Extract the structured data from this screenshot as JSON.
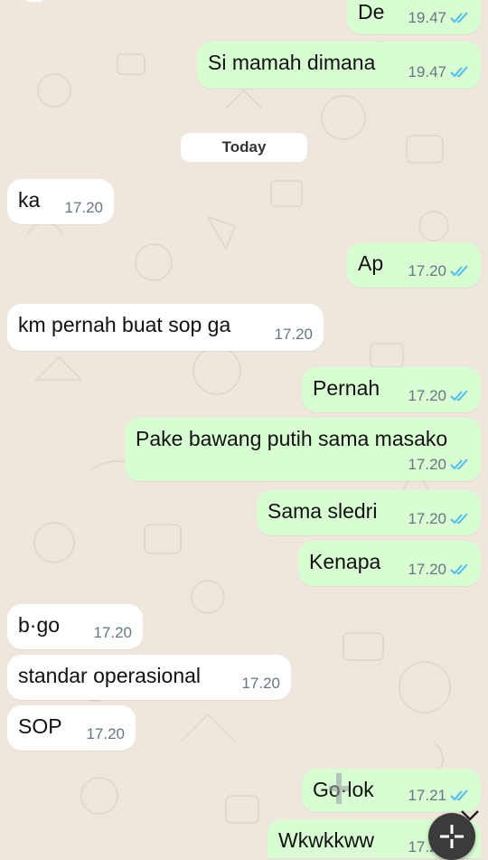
{
  "date_separator": "Today",
  "messages": [
    {
      "text": "De",
      "time": "19.47",
      "dir": "out",
      "read": true
    },
    {
      "text": "Si mamah dimana",
      "time": "19.47",
      "dir": "out",
      "read": true
    },
    {
      "text": "ka",
      "time": "17.20",
      "dir": "in"
    },
    {
      "text": "Ap",
      "time": "17.20",
      "dir": "out",
      "read": true
    },
    {
      "text": "km pernah buat sop ga",
      "time": "17.20",
      "dir": "in"
    },
    {
      "text": "Pernah",
      "time": "17.20",
      "dir": "out",
      "read": true
    },
    {
      "text": "Pake bawang putih sama masako",
      "time": "17.20",
      "dir": "out",
      "read": true
    },
    {
      "text": "Sama sledri",
      "time": "17.20",
      "dir": "out",
      "read": true
    },
    {
      "text": "Kenapa",
      "time": "17.20",
      "dir": "out",
      "read": true
    },
    {
      "text": "b·go",
      "time": "17.20",
      "dir": "in"
    },
    {
      "text": "standar operasional",
      "time": "17.20",
      "dir": "in"
    },
    {
      "text": "SOP",
      "time": "17.20",
      "dir": "in"
    },
    {
      "text": "Go·lok",
      "time": "17.21",
      "dir": "out",
      "read": true
    },
    {
      "text": "Wkwkkww",
      "time": "17.21",
      "dir": "out",
      "read": true
    }
  ],
  "icons": {
    "read_ticks": "double-check-icon",
    "scroll_down": "chevron-down-icon",
    "fab": "expand-icon"
  },
  "colors": {
    "outgoing": "#d9fdd3",
    "incoming": "#ffffff",
    "tick": "#53bdeb",
    "wallpaper": "#efe7dd"
  }
}
